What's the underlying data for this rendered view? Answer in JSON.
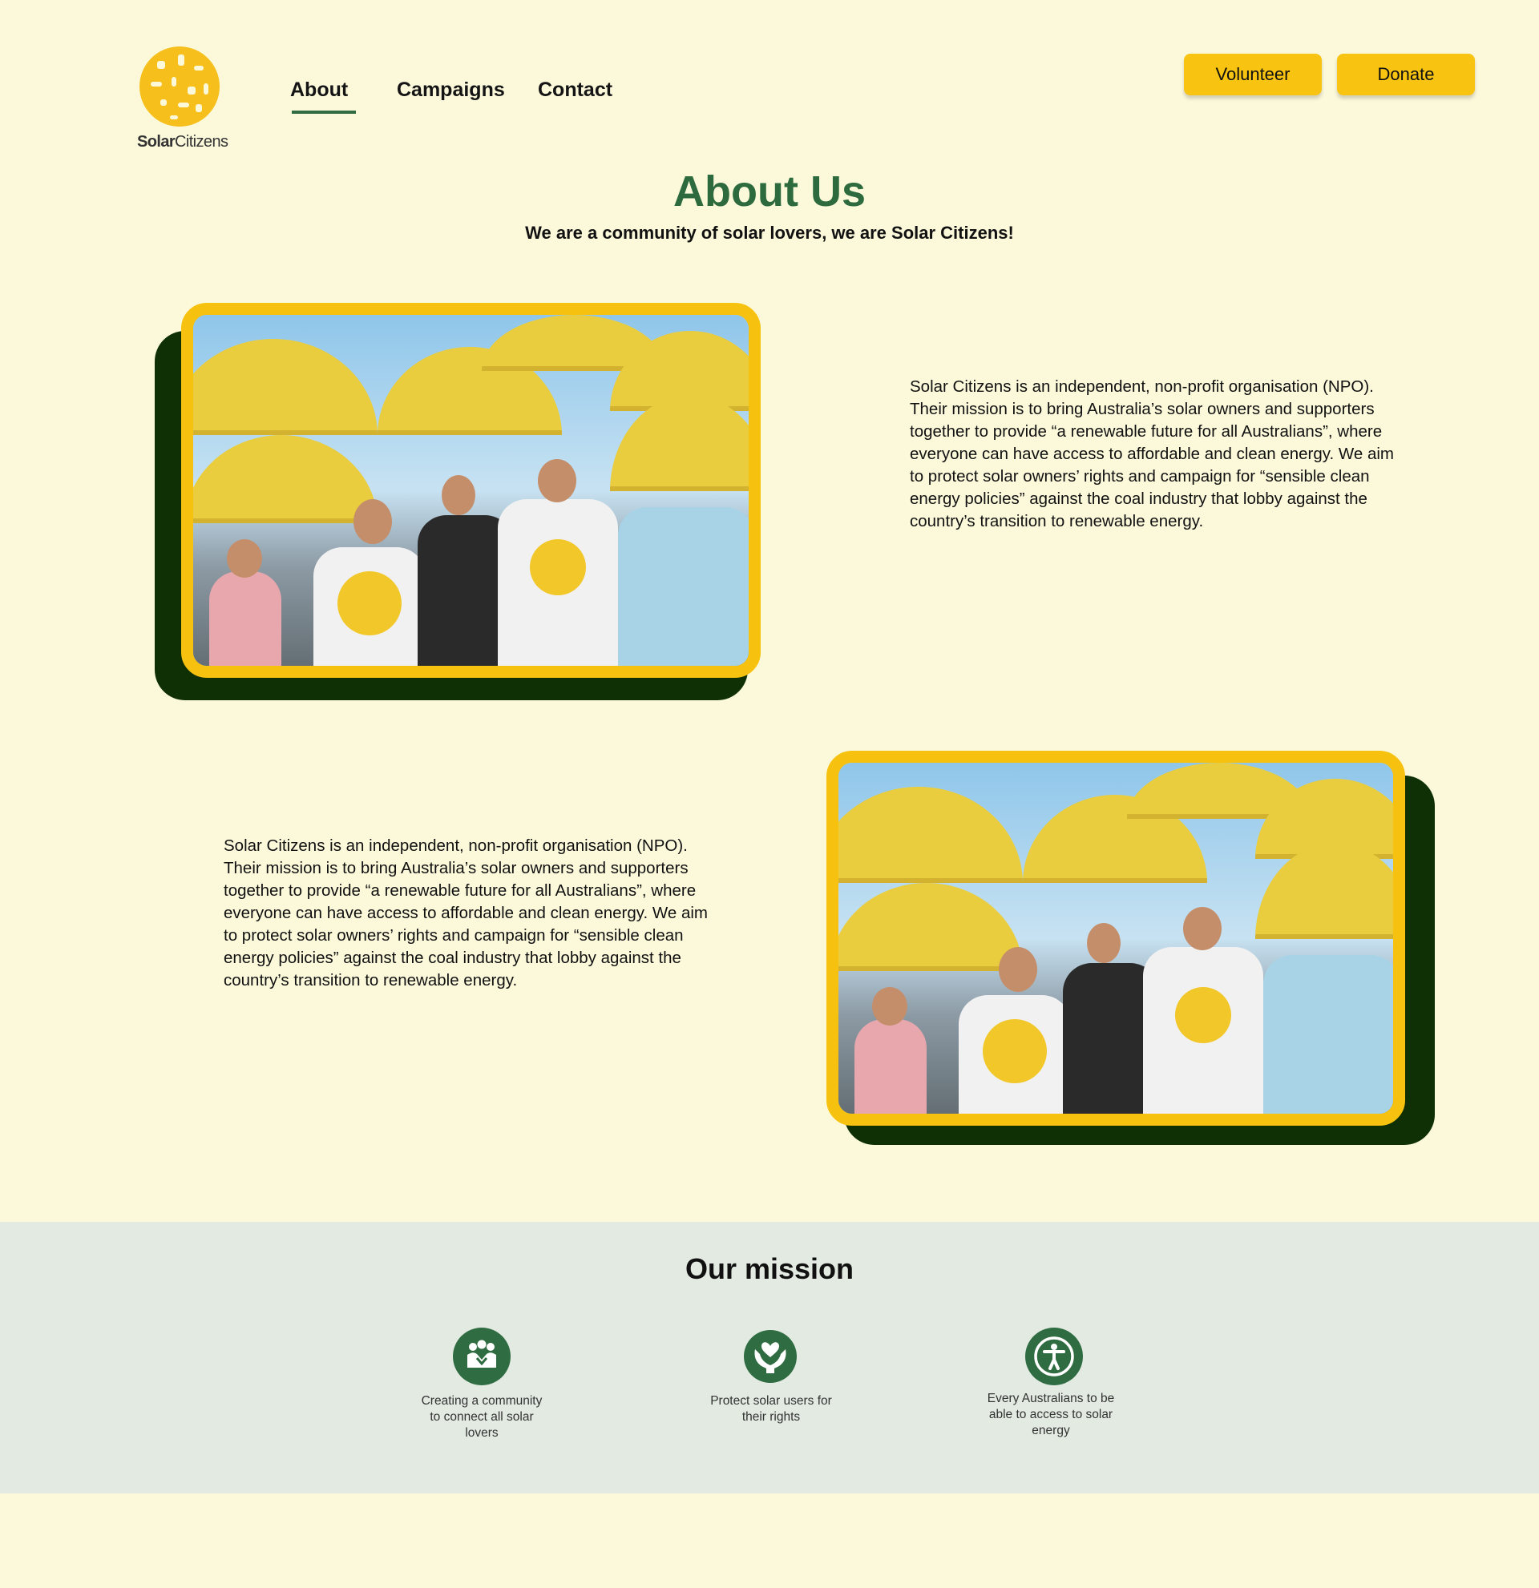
{
  "header": {
    "logo_text_bold": "Solar",
    "logo_text_regular": "Citizens",
    "nav": [
      {
        "label": "About",
        "active": true
      },
      {
        "label": "Campaigns",
        "active": false
      },
      {
        "label": "Contact",
        "active": false
      }
    ],
    "volunteer_label": "Volunteer",
    "donate_label": "Donate"
  },
  "about": {
    "title": "About Us",
    "subtitle": "We are a community of solar lovers, we are Solar Citizens!"
  },
  "features": [
    {
      "text": "Solar Citizens is an independent, non-profit organisation (NPO). Their mission is to bring Australia’s solar owners and supporters together to provide “a renewable future for all Australians”, where everyone can have access to affordable and clean energy. We aim to protect solar owners’ rights and campaign for “sensible clean energy policies” against the coal industry that lobby against the country’s transition to renewable energy."
    },
    {
      "text": "Solar Citizens is an independent, non-profit organisation (NPO). Their mission is to bring Australia’s solar owners and supporters together to provide “a renewable future for all Australians”, where everyone can have access to affordable and clean energy. We aim to protect solar owners’ rights and campaign for “sensible clean energy policies” against the coal industry that lobby against the country’s transition to renewable energy."
    }
  ],
  "mission": {
    "title": "Our mission",
    "items": [
      {
        "icon": "community-icon",
        "text": "Creating a community to connect all solar lovers"
      },
      {
        "icon": "heart-hands-icon",
        "text": "Protect solar users for their rights"
      },
      {
        "icon": "accessibility-icon",
        "text": "Every Australians to be able to access to solar energy"
      }
    ]
  },
  "colors": {
    "page_background": "#fcf9db",
    "accent_yellow": "#f8c311",
    "brand_green": "#2d6a3e",
    "dark_green_shadow": "#0f3005",
    "mission_background": "#e2eae2"
  }
}
